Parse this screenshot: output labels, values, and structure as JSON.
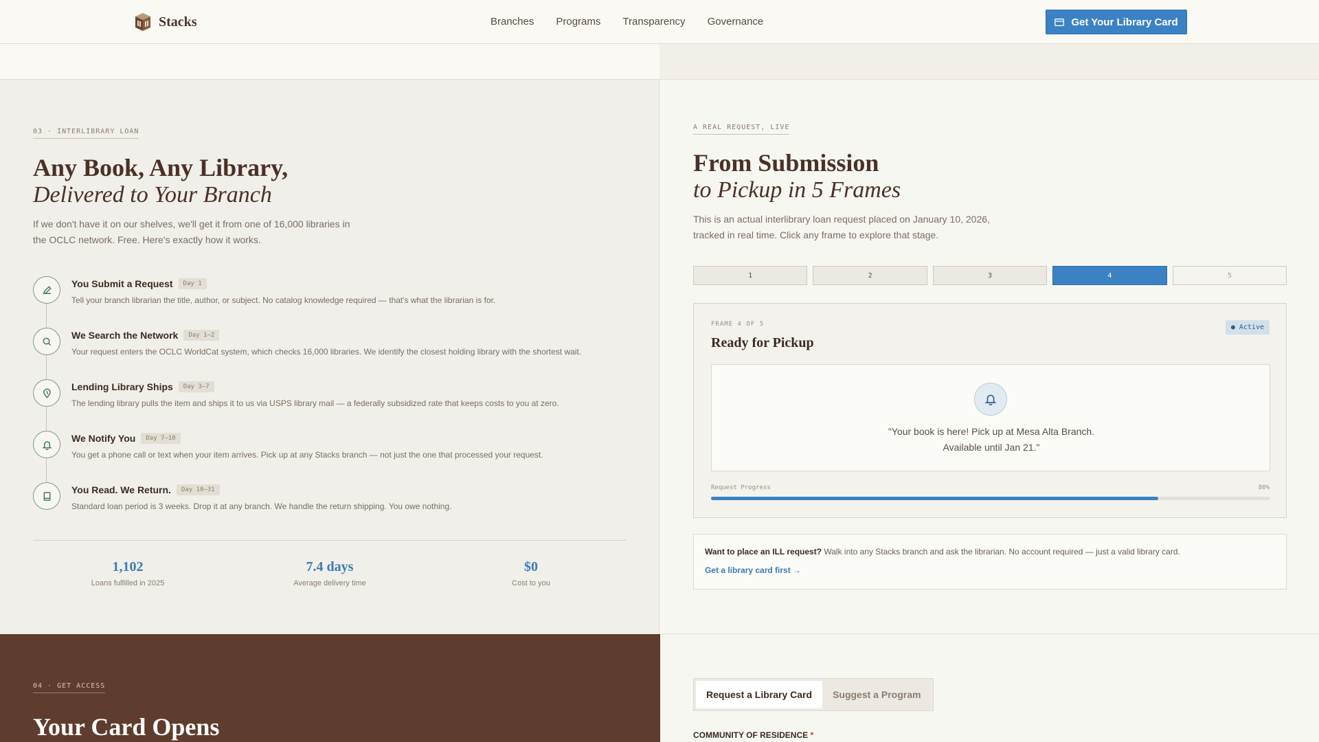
{
  "header": {
    "brand": "Stacks",
    "nav": [
      "Branches",
      "Programs",
      "Transparency",
      "Governance"
    ],
    "cta_label": "Get Your Library Card",
    "cta_icon": "card-icon"
  },
  "ill_section": {
    "eyebrow": "03 · INTERLIBRARY LOAN",
    "title": "Any Book, Any Library,",
    "subtitle": "Delivered to Your Branch",
    "intro": "If we don't have it on our shelves, we'll get it from one of 16,000 libraries in the OCLC network. Free. Here's exactly how it works.",
    "steps": [
      {
        "icon": "pencil-icon",
        "title": "You Submit a Request",
        "day": "Day 1",
        "desc": "Tell your branch librarian the title, author, or subject. No catalog knowledge required — that's what the librarian is for."
      },
      {
        "icon": "search-icon",
        "title": "We Search the Network",
        "day": "Day 1–2",
        "desc": "Your request enters the OCLC WorldCat system, which checks 16,000 libraries. We identify the closest holding library with the shortest wait."
      },
      {
        "icon": "location-pin-icon",
        "title": "Lending Library Ships",
        "day": "Day 3–7",
        "desc": "The lending library pulls the item and ships it to us via USPS library mail — a federally subsidized rate that keeps costs to you at zero."
      },
      {
        "icon": "bell-icon",
        "title": "We Notify You",
        "day": "Day 7–10",
        "desc": "You get a phone call or text when your item arrives. Pick up at any Stacks branch — not just the one that processed your request."
      },
      {
        "icon": "book-icon",
        "title": "You Read. We Return.",
        "day": "Day 10–31",
        "desc": "Standard loan period is 3 weeks. Drop it at any branch. We handle the return shipping. You owe nothing."
      }
    ],
    "stats": [
      {
        "value": "1,102",
        "label": "Loans fulfilled in 2025"
      },
      {
        "value": "7.4 days",
        "label": "Average delivery time"
      },
      {
        "value": "$0",
        "label": "Cost to you"
      }
    ]
  },
  "tracker": {
    "eyebrow": "A REAL REQUEST, LIVE",
    "title": "From Submission",
    "subtitle": "to Pickup in 5 Frames",
    "intro": "This is an actual interlibrary loan request placed on January 10, 2026, tracked in real time. Click any frame to explore that stage.",
    "frames": [
      "1",
      "2",
      "3",
      "4",
      "5"
    ],
    "active_frame": 4,
    "card": {
      "label": "FRAME 4 OF 5",
      "title": "Ready for Pickup",
      "badge": "● Active",
      "message_line1": "\"Your book is here! Pick up at Mesa Alta Branch.",
      "message_line2": "Available until Jan 21.\"",
      "progress_label": "Request Progress",
      "progress_pct": "80%",
      "progress_value": 0.8
    },
    "cta_box": {
      "lead": "Want to place an ILL request?",
      "text": " Walk into any Stacks branch and ask the librarian. No account required — just a valid library card.",
      "link": "Get a library card first →"
    }
  },
  "access_section": {
    "eyebrow": "04 · GET ACCESS",
    "title": "Your Card Opens",
    "tabs": [
      "Request a Library Card",
      "Suggest a Program"
    ],
    "field_label": "COMMUNITY OF RESIDENCE",
    "required_mark": "*"
  },
  "colors": {
    "accent": "#3b82c4",
    "brown": "#5e3c2e",
    "sage": "#7d9a8d"
  }
}
